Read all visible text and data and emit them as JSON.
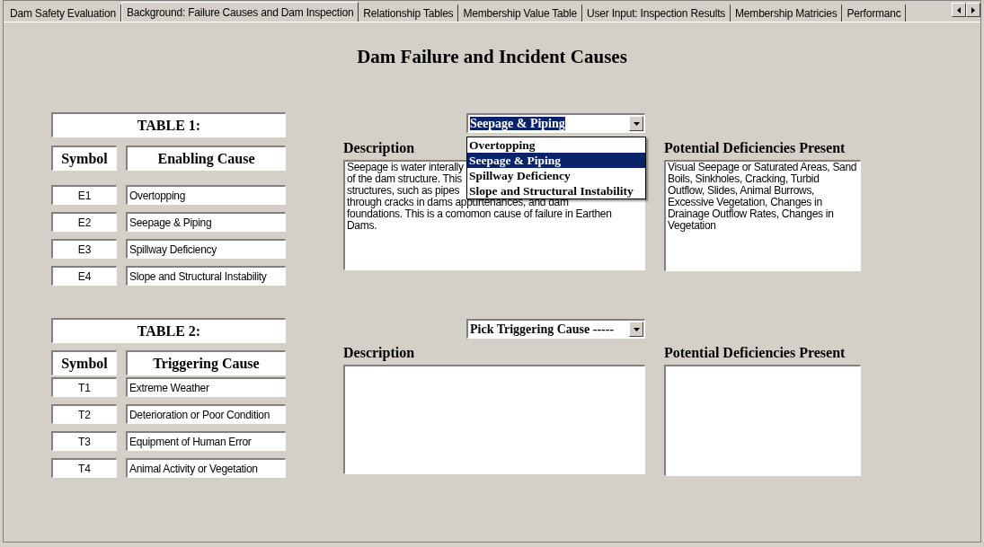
{
  "tabs": [
    {
      "label": "Dam Safety Evaluation",
      "selected": false
    },
    {
      "label": "Background: Failure Causes and Dam Inspection",
      "selected": true
    },
    {
      "label": "Relationship Tables",
      "selected": false
    },
    {
      "label": "Membership Value Table",
      "selected": false
    },
    {
      "label": "User Input: Inspection Results",
      "selected": false
    },
    {
      "label": "Membership Matricies",
      "selected": false
    },
    {
      "label": "Performanc",
      "selected": false
    }
  ],
  "title": "Dam Failure and Incident Causes",
  "sections": [
    {
      "table": {
        "title": "TABLE 1:",
        "symbol_header": "Symbol",
        "cause_header": "Enabling Cause",
        "rows": [
          {
            "symbol": "E1",
            "cause": "Overtopping"
          },
          {
            "symbol": "E2",
            "cause": "Seepage & Piping"
          },
          {
            "symbol": "E3",
            "cause": "Spillway Deficiency"
          },
          {
            "symbol": "E4",
            "cause": "Slope and Structural Instability"
          }
        ]
      },
      "dropdown": {
        "value": "Seepage & Piping",
        "expanded": true,
        "options": [
          {
            "label": "Overtopping",
            "selected": false
          },
          {
            "label": "Seepage & Piping",
            "selected": true
          },
          {
            "label": "Spillway Deficiency",
            "selected": false
          },
          {
            "label": "Slope and Structural Instability",
            "selected": false
          }
        ]
      },
      "description": {
        "label": "Description",
        "lines": [
          "Seepage is water interally",
          "of the dam structure. This",
          "structures, such as pipes",
          "through cracks in dams appurtenances, and dam",
          "foundations. This is a comomon cause of failure in Earthen",
          "Dams."
        ]
      },
      "deficiencies": {
        "label": "Potential Deficiencies Present",
        "text": "Visual Seepage or Saturated Areas, Sand Boils, Sinkholes, Cracking, Turbid Outflow, Slides, Animal Burrows, Excessive Vegetation, Changes in Drainage Outflow Rates, Changes in Vegetation"
      }
    },
    {
      "table": {
        "title": "TABLE 2:",
        "symbol_header": "Symbol",
        "cause_header": "Triggering Cause",
        "rows": [
          {
            "symbol": "T1",
            "cause": "Extreme Weather"
          },
          {
            "symbol": "T2",
            "cause": "Deterioration or Poor Condition"
          },
          {
            "symbol": "T3",
            "cause": "Equipment of Human Error"
          },
          {
            "symbol": "T4",
            "cause": "Animal Activity or Vegetation"
          }
        ]
      },
      "dropdown": {
        "value": "Pick Triggering Cause -----",
        "expanded": false
      },
      "description": {
        "label": "Description"
      },
      "deficiencies": {
        "label": "Potential Deficiencies Present"
      }
    }
  ]
}
